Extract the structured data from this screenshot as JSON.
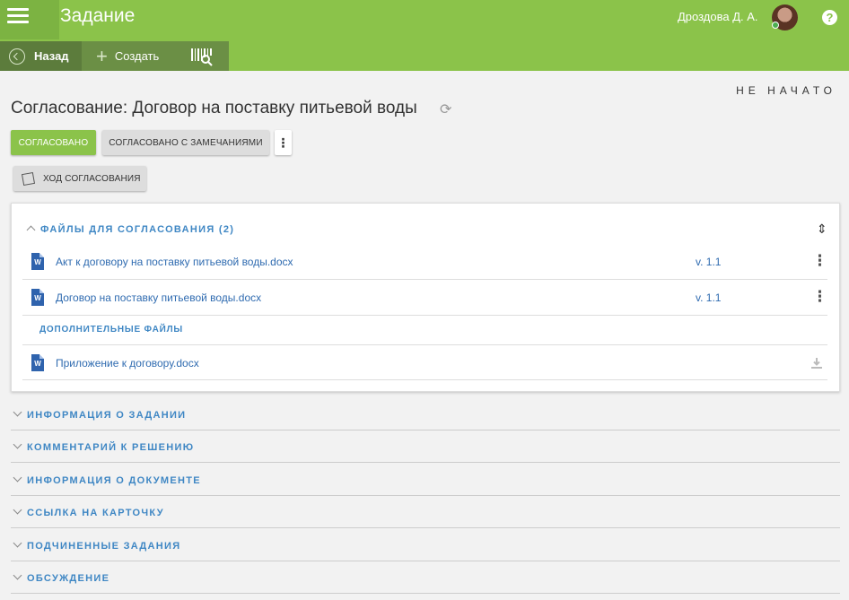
{
  "header": {
    "title": "Задание",
    "user": "Дроздова Д. А.",
    "help": "?"
  },
  "toolbar": {
    "back": "Назад",
    "create": "Создать"
  },
  "status": "НЕ НАЧАТО",
  "document": {
    "title": "Согласование: Договор на поставку питьевой воды"
  },
  "actions": {
    "approve": "Согласовано",
    "approve_remarks": "Согласовано с замечаниями",
    "more": "⋮",
    "progress": "Ход согласования"
  },
  "files": {
    "header": "Файлы для согласования (2)",
    "items": [
      {
        "name": "Акт к договору на поставку питьевой воды.docx",
        "version": "v. 1.1"
      },
      {
        "name": "Договор на поставку питьевой воды.docx",
        "version": "v. 1.1"
      }
    ],
    "extra_header": "Дополнительные файлы",
    "extra": [
      {
        "name": "Приложение к договору.docx"
      }
    ]
  },
  "sections": [
    "Информация о задании",
    "Комментарий к решению",
    "Информация о документе",
    "Ссылка на карточку",
    "Подчиненные задания",
    "Обсуждение"
  ],
  "colors": {
    "primary": "#8bc34a",
    "toolbar_dark": "#6b8f45",
    "link": "#2f6bb0",
    "word": "#2f63ad"
  }
}
